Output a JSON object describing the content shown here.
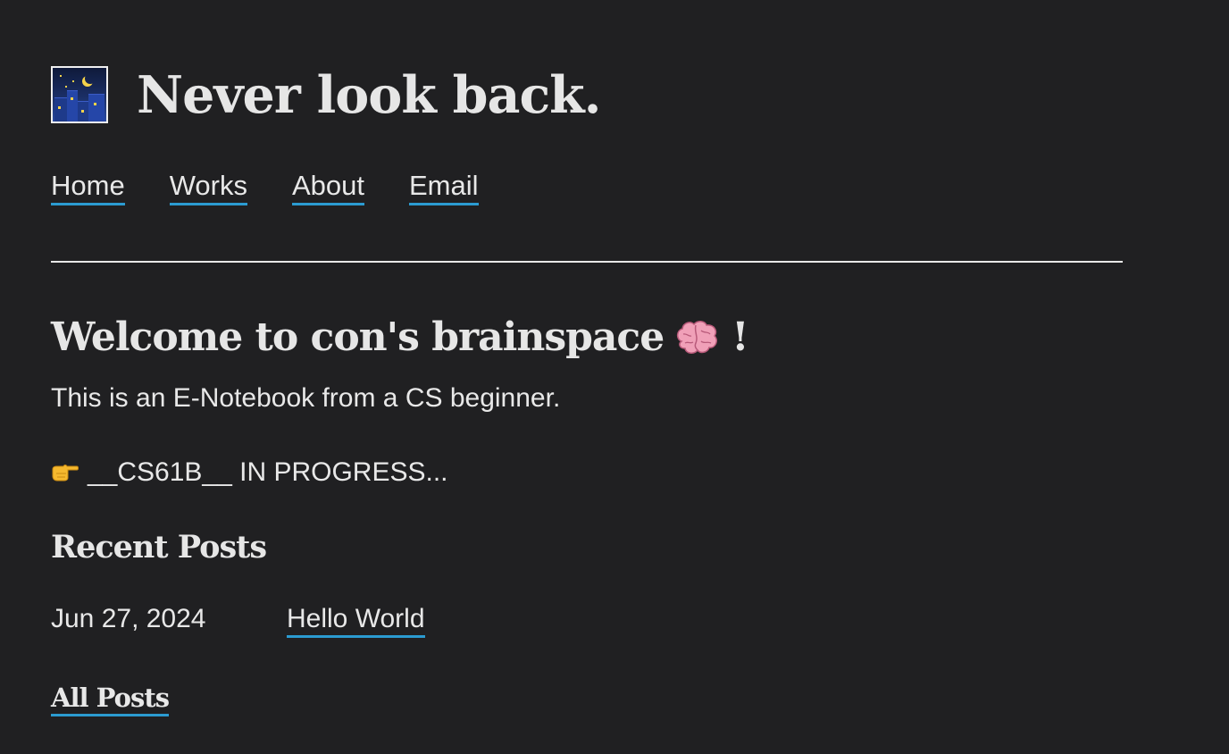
{
  "header": {
    "logo_icon": "night-city-icon",
    "title": "Never look back."
  },
  "nav": {
    "items": [
      {
        "label": "Home"
      },
      {
        "label": "Works"
      },
      {
        "label": "About"
      },
      {
        "label": "Email"
      }
    ]
  },
  "main": {
    "welcome_text": "Welcome to con's brainspace",
    "welcome_icon": "brain-icon",
    "welcome_suffix": "!",
    "intro": "This is an E-Notebook from a CS beginner.",
    "progress_icon": "pointing-right-icon",
    "progress_text": "__CS61B__ IN PROGRESS...",
    "recent_heading": "Recent Posts",
    "posts": [
      {
        "date": "Jun 27, 2024",
        "title": "Hello World"
      }
    ],
    "all_posts_label": "All Posts"
  },
  "colors": {
    "background": "#202022",
    "text": "#e8e8e8",
    "link_underline": "#2b9bd1"
  }
}
